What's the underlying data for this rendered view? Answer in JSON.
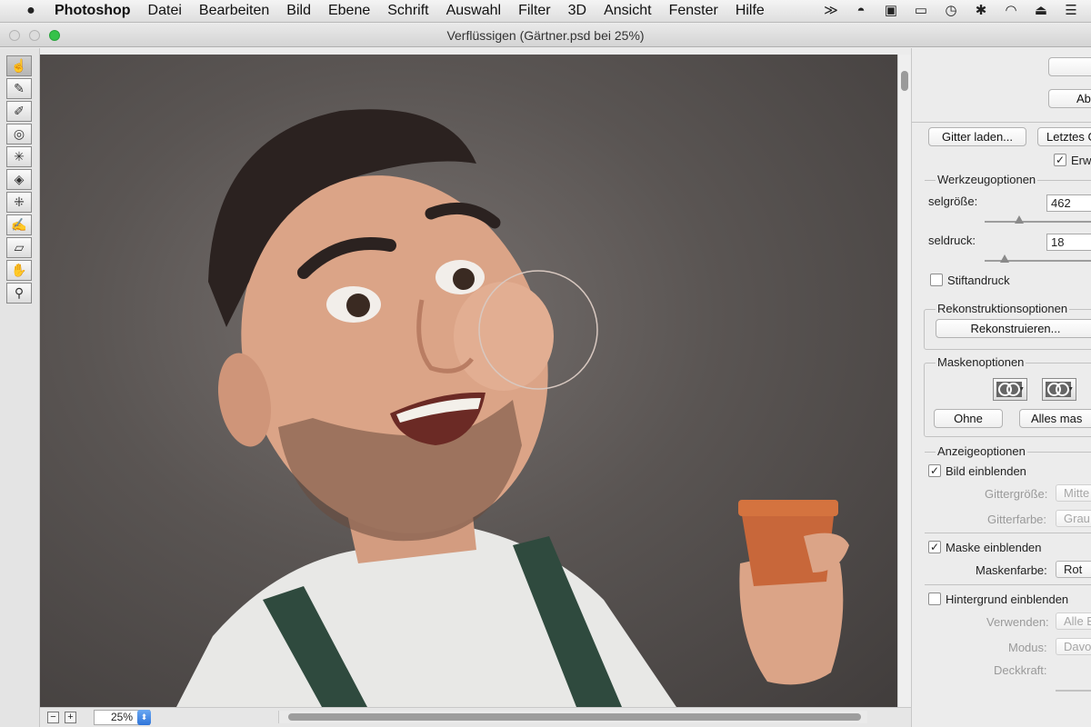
{
  "menubar": {
    "apple_icon": "apple-icon",
    "items": [
      "Photoshop",
      "Datei",
      "Bearbeiten",
      "Bild",
      "Ebene",
      "Schrift",
      "Auswahl",
      "Filter",
      "3D",
      "Ansicht",
      "Fenster",
      "Hilfe"
    ],
    "status_icons": [
      "back-arrows-icon",
      "bowler-hat-icon",
      "display-icon",
      "airplay-icon",
      "time-machine-icon",
      "bluetooth-icon",
      "wifi-icon",
      "eject-icon",
      "list-icon"
    ]
  },
  "window": {
    "title": "Verflüssigen (Gärtner.psd bei 25%)"
  },
  "tools": [
    "forward-warp-tool-icon",
    "reconstruct-tool-icon",
    "smooth-tool-icon",
    "twirl-clockwise-tool-icon",
    "pucker-tool-icon",
    "bloat-tool-icon",
    "push-left-tool-icon",
    "freeze-mask-tool-icon",
    "thaw-mask-tool-icon",
    "hand-tool-icon",
    "zoom-tool-icon"
  ],
  "statusbar": {
    "zoom_value": "25%",
    "zoom_out": "−",
    "zoom_in": "+"
  },
  "panel": {
    "ok_label": "",
    "cancel_label": "Ab",
    "load_mesh": "Gitter laden...",
    "last_mesh": "Letztes G",
    "advanced_label": "Erw",
    "tool_options": {
      "title": "Werkzeugoptionen",
      "brush_size_label": "selgröße:",
      "brush_size_value": "462",
      "brush_pressure_label": "seldruck:",
      "brush_pressure_value": "18",
      "stylus_label": "Stiftandruck"
    },
    "reconstruct_options": {
      "title": "Rekonstruktionsoptionen",
      "reconstruct_button": "Rekonstruieren..."
    },
    "mask_options": {
      "title": "Maskenoptionen",
      "none_button": "Ohne",
      "mask_all_button": "Alles mas"
    },
    "view_options": {
      "title": "Anzeigeoptionen",
      "show_image": "Bild einblenden",
      "mesh_size_label": "Gittergröße:",
      "mesh_size_value": "Mitte",
      "mesh_color_label": "Gitterfarbe:",
      "mesh_color_value": "Grau",
      "show_mask": "Maske einblenden",
      "mask_color_label": "Maskenfarbe:",
      "mask_color_value": "Rot",
      "show_backdrop": "Hintergrund einblenden",
      "use_label": "Verwenden:",
      "use_value": "Alle E",
      "mode_label": "Modus:",
      "mode_value": "Davo",
      "opacity_label": "Deckkraft:"
    },
    "checkmark": "✓"
  }
}
